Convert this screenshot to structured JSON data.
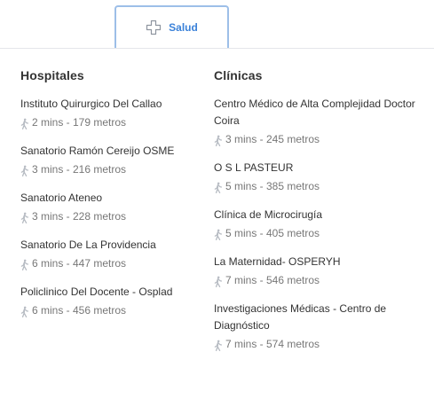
{
  "tab": {
    "label": "Salud",
    "icon": "plus-cross-icon"
  },
  "hospitals": {
    "title": "Hospitales",
    "items": [
      {
        "name": "Instituto Quirurgico Del Callao",
        "distance": "2 mins - 179 metros"
      },
      {
        "name": "Sanatorio Ramón Cereijo OSME",
        "distance": "3 mins - 216 metros"
      },
      {
        "name": "Sanatorio Ateneo",
        "distance": "3 mins - 228 metros"
      },
      {
        "name": "Sanatorio De La Providencia",
        "distance": "6 mins - 447 metros"
      },
      {
        "name": "Policlinico Del Docente - Osplad",
        "distance": "6 mins - 456 metros"
      }
    ]
  },
  "clinics": {
    "title": "Clínicas",
    "items": [
      {
        "name": "Centro Médico de Alta Complejidad Doctor Coira",
        "distance": "3 mins - 245 metros"
      },
      {
        "name": "O S L PASTEUR",
        "distance": "5 mins - 385 metros"
      },
      {
        "name": "Clínica de Microcirugía",
        "distance": "5 mins - 405 metros"
      },
      {
        "name": "La Maternidad- OSPERYH",
        "distance": "7 mins - 546 metros"
      },
      {
        "name": "Investigaciones Médicas - Centro de Diagnóstico",
        "distance": "7 mins - 574 metros"
      }
    ]
  },
  "colors": {
    "accent": "#3b82d9",
    "tab_border": "#9dbfe8",
    "muted": "#777777",
    "text": "#333333"
  }
}
